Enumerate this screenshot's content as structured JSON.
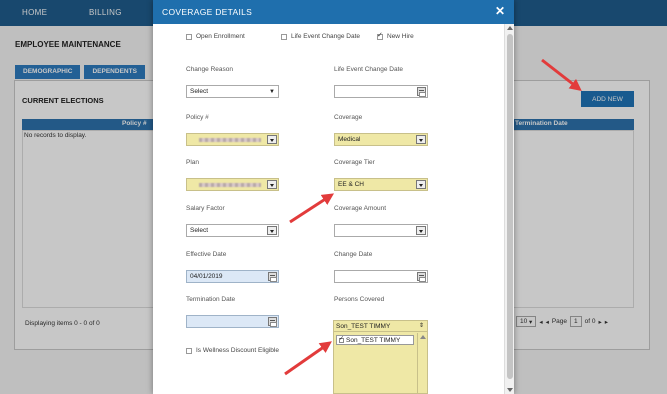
{
  "background": {
    "nav": {
      "home": "HOME",
      "billing": "BILLING"
    },
    "page_title": "EMPLOYEE MAINTENANCE",
    "tabs": [
      "DEMOGRAPHIC",
      "DEPENDENTS"
    ],
    "section_title": "CURRENT ELECTIONS",
    "add_new": "ADD NEW",
    "grid_headers": {
      "policy": "Policy #",
      "termination_date": "Termination Date"
    },
    "no_records": "No records to display.",
    "displaying": "Displaying items 0 - 0 of 0",
    "pager": {
      "page_size": "10",
      "page_label": "Page",
      "page_value": "1",
      "of_label": "of 0"
    }
  },
  "modal": {
    "title": "COVERAGE DETAILS",
    "close": "✕",
    "event_type": [
      {
        "label": "Open Enrollment",
        "checked": false
      },
      {
        "label": "Life Event Change Date",
        "checked": false
      },
      {
        "label": "New Hire",
        "checked": true
      }
    ],
    "fields": {
      "change_reason": {
        "label": "Change Reason",
        "value": "Select"
      },
      "life_event_change_date": {
        "label": "Life Event Change Date",
        "value": ""
      },
      "policy": {
        "label": "Policy #",
        "value": ""
      },
      "coverage": {
        "label": "Coverage",
        "value": "Medical"
      },
      "plan": {
        "label": "Plan",
        "value": ""
      },
      "coverage_tier": {
        "label": "Coverage Tier",
        "value": "EE & CH"
      },
      "salary_factor": {
        "label": "Salary Factor",
        "value": "Select"
      },
      "coverage_amount": {
        "label": "Coverage Amount",
        "value": ""
      },
      "effective_date": {
        "label": "Effective Date",
        "value": "04/01/2019"
      },
      "change_date": {
        "label": "Change Date",
        "value": ""
      },
      "termination_date": {
        "label": "Termination Date",
        "value": ""
      },
      "persons_covered": {
        "label": "Persons Covered",
        "selected": "Son_TEST TIMMY",
        "items": [
          {
            "label": "Son_TEST TIMMY",
            "checked": true
          }
        ]
      }
    },
    "wellness": {
      "label": "Is Wellness Discount Eligible",
      "checked": false
    }
  },
  "colors": {
    "header_blue": "#1f6fad",
    "highlight_yellow": "#efe8a6",
    "arrow_red": "#e23b3b"
  }
}
